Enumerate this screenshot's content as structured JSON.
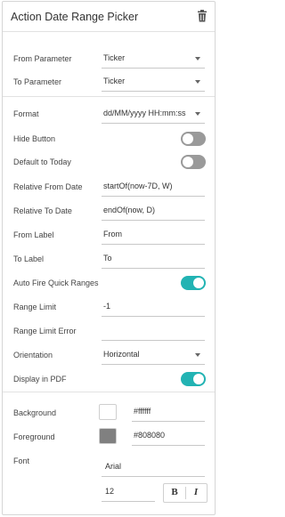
{
  "header": {
    "title": "Action Date Range Picker",
    "delete_icon": "trash-icon"
  },
  "params": {
    "from_label": "From Parameter",
    "from_value": "Ticker",
    "to_label": "To Parameter",
    "to_value": "Ticker"
  },
  "settings": {
    "format_label": "Format",
    "format_value": "dd/MM/yyyy HH:mm:ss",
    "hide_button_label": "Hide Button",
    "hide_button_on": false,
    "default_today_label": "Default to Today",
    "default_today_on": false,
    "rel_from_label": "Relative From Date",
    "rel_from_value": "startOf(now-7D, W)",
    "rel_to_label": "Relative To Date",
    "rel_to_value": "endOf(now, D)",
    "from_text_label": "From Label",
    "from_text_value": "From",
    "to_text_label": "To Label",
    "to_text_value": "To",
    "auto_fire_label": "Auto Fire Quick Ranges",
    "auto_fire_on": true,
    "range_limit_label": "Range Limit",
    "range_limit_value": "-1",
    "range_limit_error_label": "Range Limit Error",
    "range_limit_error_value": "",
    "orientation_label": "Orientation",
    "orientation_value": "Horizontal",
    "display_pdf_label": "Display in PDF",
    "display_pdf_on": true
  },
  "style": {
    "background_label": "Background",
    "background_hex": "#ffffff",
    "background_color": "#ffffff",
    "foreground_label": "Foreground",
    "foreground_hex": "#808080",
    "foreground_color": "#808080",
    "font_label": "Font",
    "font_name": "Arial",
    "font_size": "12",
    "bold_label": "B",
    "italic_label": "I"
  },
  "accent_color": "#22b3b3"
}
